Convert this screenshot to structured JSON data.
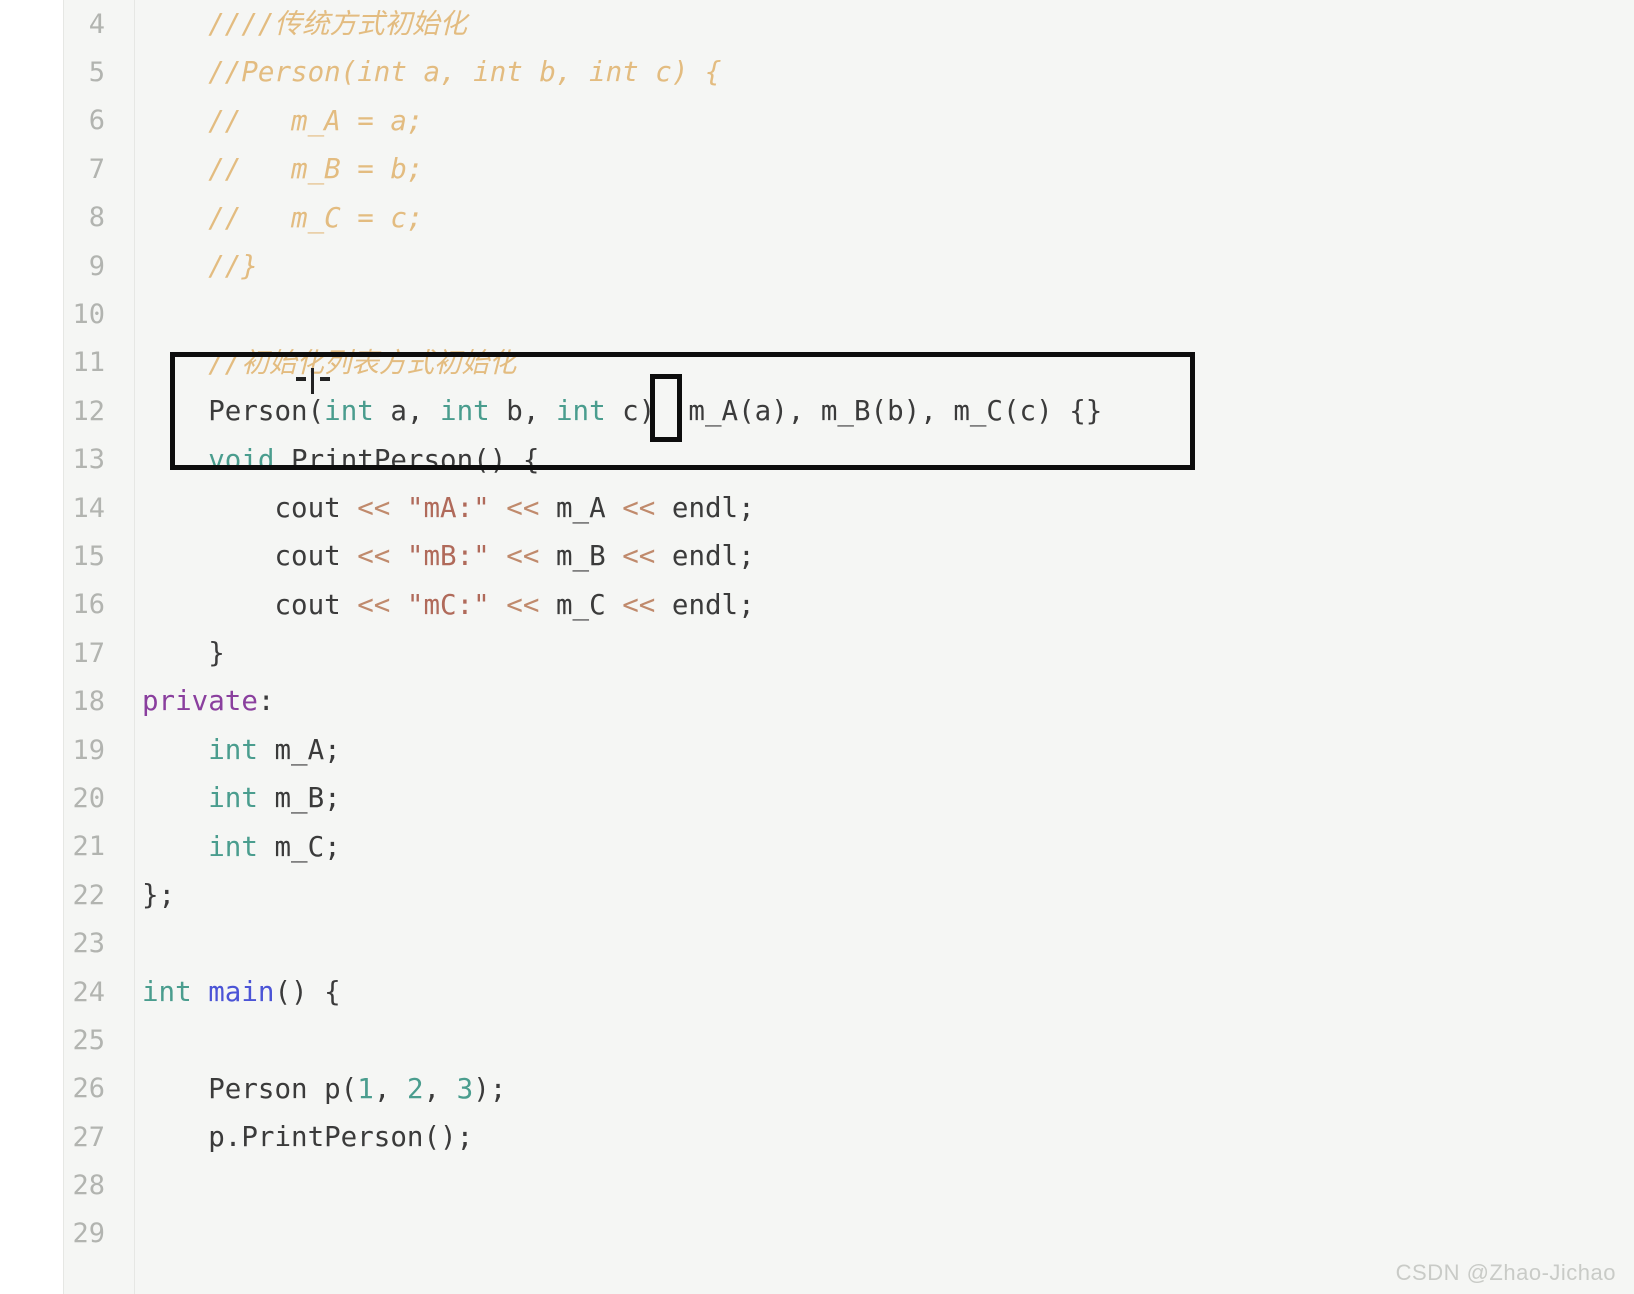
{
  "editor": {
    "watermark": "CSDN @Zhao-Jichao",
    "first_line_number": 4,
    "last_line_number": 29,
    "colors": {
      "background": "#f5f6f4",
      "gutter_background": "#f5f6f4",
      "line_number": "#b2b4b0",
      "comment": "#e3bc80",
      "keyword": "#4a9d8e",
      "access_specifier": "#8a3f9e",
      "function_name": "#4b54d6",
      "string": "#b06a5a",
      "operator": "#c08a6c",
      "number": "#4a9d8e",
      "plain_text": "#3b3b3b",
      "annotation": "#0d0d0d",
      "watermark": "#c9cbc7"
    },
    "lines": [
      {
        "number": 4,
        "text": "    ////传统方式初始化"
      },
      {
        "number": 5,
        "text": "    //Person(int a, int b, int c) {"
      },
      {
        "number": 6,
        "text": "    //   m_A = a;"
      },
      {
        "number": 7,
        "text": "    //   m_B = b;"
      },
      {
        "number": 8,
        "text": "    //   m_C = c;"
      },
      {
        "number": 9,
        "text": "    //}"
      },
      {
        "number": 10,
        "text": ""
      },
      {
        "number": 11,
        "text": "    //初始化列表方式初始化"
      },
      {
        "number": 12,
        "text": "    Person(int a, int b, int c) :m_A(a), m_B(b), m_C(c) {}"
      },
      {
        "number": 13,
        "text": "    void PrintPerson() {"
      },
      {
        "number": 14,
        "text": "        cout << \"mA:\" << m_A << endl;"
      },
      {
        "number": 15,
        "text": "        cout << \"mB:\" << m_B << endl;"
      },
      {
        "number": 16,
        "text": "        cout << \"mC:\" << m_C << endl;"
      },
      {
        "number": 17,
        "text": "    }"
      },
      {
        "number": 18,
        "text": "private:"
      },
      {
        "number": 19,
        "text": "    int m_A;"
      },
      {
        "number": 20,
        "text": "    int m_B;"
      },
      {
        "number": 21,
        "text": "    int m_C;"
      },
      {
        "number": 22,
        "text": "};"
      },
      {
        "number": 23,
        "text": ""
      },
      {
        "number": 24,
        "text": "int main() {"
      },
      {
        "number": 25,
        "text": ""
      },
      {
        "number": 26,
        "text": "    Person p(1, 2, 3);"
      },
      {
        "number": 27,
        "text": "    p.PrintPerson();"
      },
      {
        "number": 28,
        "text": ""
      },
      {
        "number": 29,
        "text": ""
      }
    ]
  },
  "line_numbers": {
    "n4": "4",
    "n5": "5",
    "n6": "6",
    "n7": "7",
    "n8": "8",
    "n9": "9",
    "n10": "10",
    "n11": "11",
    "n12": "12",
    "n13": "13",
    "n14": "14",
    "n15": "15",
    "n16": "16",
    "n17": "17",
    "n18": "18",
    "n19": "19",
    "n20": "20",
    "n21": "21",
    "n22": "22",
    "n23": "23",
    "n24": "24",
    "n25": "25",
    "n26": "26",
    "n27": "27",
    "n28": "28",
    "n29": "29"
  },
  "tokens": {
    "l4_comment": "////传统方式初始化",
    "l5_comment": "//Person(int a, int b, int c) {",
    "l6_comment": "//   m_A = a;",
    "l7_comment": "//   m_B = b;",
    "l8_comment": "//   m_C = c;",
    "l9_comment": "//}",
    "l11_comment": "//初始化列表方式初始化",
    "l12_person": "Person(",
    "l12_int1": "int",
    "l12_a": " a, ",
    "l12_int2": "int",
    "l12_b": " b, ",
    "l12_int3": "int",
    "l12_c": " c) ",
    "l12_colon": ":",
    "l12_init": "m_A(a), m_B(b), m_C(c) {}",
    "l13_void": "void",
    "l13_space": " ",
    "l13_fn": "PrintPerson",
    "l13_tail": "() {",
    "l14_cout": "cout ",
    "l14_op1": "<<",
    "l14_str": " \"mA:\" ",
    "l14_op2": "<<",
    "l14_var": " m_A ",
    "l14_op3": "<<",
    "l14_endl": " endl;",
    "l15_cout": "cout ",
    "l15_op1": "<<",
    "l15_str": " \"mB:\" ",
    "l15_op2": "<<",
    "l15_var": " m_B ",
    "l15_op3": "<<",
    "l15_endl": " endl;",
    "l16_cout": "cout ",
    "l16_op1": "<<",
    "l16_str": " \"mC:\" ",
    "l16_op2": "<<",
    "l16_var": " m_C ",
    "l16_op3": "<<",
    "l16_endl": " endl;",
    "l17_brace": "}",
    "l18_private": "private",
    "l18_colon": ":",
    "l19_int": "int",
    "l19_var": " m_A;",
    "l20_int": "int",
    "l20_var": " m_B;",
    "l21_int": "int",
    "l21_var": " m_C;",
    "l22_close": "};",
    "l24_int": "int",
    "l24_sp": " ",
    "l24_main": "main",
    "l24_tail": "() {",
    "l26_person": "Person p(",
    "l26_n1": "1",
    "l26_c1": ", ",
    "l26_n2": "2",
    "l26_c2": ", ",
    "l26_n3": "3",
    "l26_tail": ");",
    "l27_call": "p.PrintPerson();"
  },
  "indent": {
    "i4": "    ",
    "i8": "        "
  },
  "annotations": {
    "highlight_box_label": "initializer-list-constructor-highlight",
    "colon_box_label": "colon-operator-highlight"
  }
}
